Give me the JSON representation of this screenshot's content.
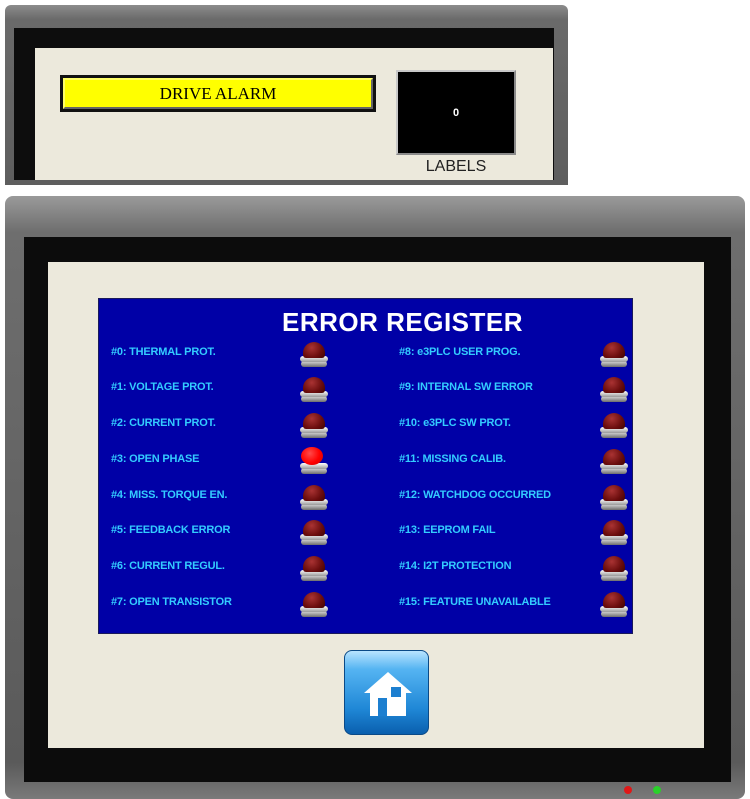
{
  "top_panel": {
    "alarm_label": "DRIVE ALARM",
    "display_value": "0",
    "display_caption": "LABELS"
  },
  "error_register": {
    "title": "ERROR REGISTER",
    "left_column": [
      {
        "label": "#0: THERMAL PROT.",
        "active": false
      },
      {
        "label": "#1: VOLTAGE PROT.",
        "active": false
      },
      {
        "label": "#2: CURRENT PROT.",
        "active": false
      },
      {
        "label": "#3: OPEN PHASE",
        "active": true
      },
      {
        "label": "#4: MISS. TORQUE EN.",
        "active": false
      },
      {
        "label": "#5: FEEDBACK ERROR",
        "active": false
      },
      {
        "label": "#6: CURRENT REGUL.",
        "active": false
      },
      {
        "label": "#7: OPEN TRANSISTOR",
        "active": false
      }
    ],
    "right_column": [
      {
        "label": "#8: e3PLC USER PROG.",
        "active": false
      },
      {
        "label": "#9: INTERNAL SW ERROR",
        "active": false
      },
      {
        "label": "#10: e3PLC SW PROT.",
        "active": false
      },
      {
        "label": "#11: MISSING CALIB.",
        "active": false
      },
      {
        "label": "#12: WATCHDOG OCCURRED",
        "active": false
      },
      {
        "label": "#13: EEPROM FAIL",
        "active": false
      },
      {
        "label": "#14: I2T PROTECTION",
        "active": false
      },
      {
        "label": "#15: FEATURE UNAVAILABLE",
        "active": false
      }
    ]
  },
  "home_button": {
    "icon": "home-icon"
  },
  "status_leds": [
    {
      "name": "red-led",
      "color": "#e01818"
    },
    {
      "name": "green-led",
      "color": "#2ad12a"
    }
  ],
  "colors": {
    "register_background": "#0000a6",
    "label_text": "#33ccff",
    "alarm_background": "#ffff00",
    "lamp_off": "#6a0d0d",
    "lamp_on": "#ff0000"
  }
}
